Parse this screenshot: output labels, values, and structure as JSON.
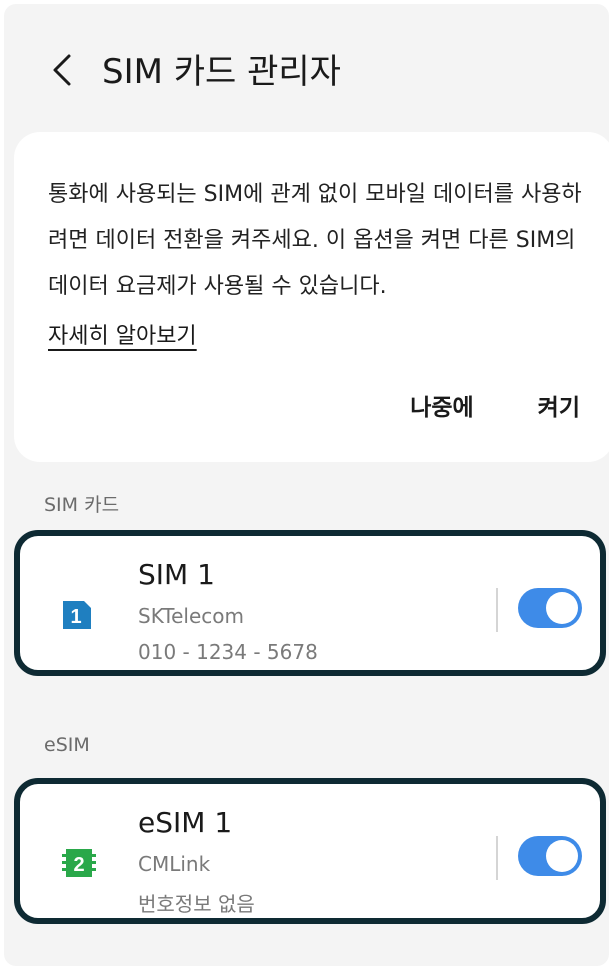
{
  "header": {
    "title": "SIM 카드 관리자"
  },
  "notice": {
    "text": "통화에 사용되는 SIM에 관계 없이 모바일 데이터를 사용하려면 데이터 전환을 켜주세요. 이 옵션을 켜면 다른 SIM의 데이터 요금제가 사용될 수 있습니다.",
    "learn_more_label": "자세히 알아보기",
    "later_label": "나중에",
    "turn_on_label": "켜기"
  },
  "sim_section": {
    "label": "SIM 카드",
    "card": {
      "icon_text": "1",
      "icon_color": "#1f7fc0",
      "title": "SIM 1",
      "carrier": "SKTelecom",
      "number": "010 - 1234 - 5678",
      "enabled": true
    }
  },
  "esim_section": {
    "label": "eSIM",
    "card": {
      "icon_text": "2",
      "icon_color": "#2aa84a",
      "title": "eSIM 1",
      "carrier": "CMLink",
      "number": "번호정보 없음",
      "enabled": true
    }
  },
  "colors": {
    "toggle_on": "#3e8be8",
    "highlight_border": "#0e2a33"
  }
}
